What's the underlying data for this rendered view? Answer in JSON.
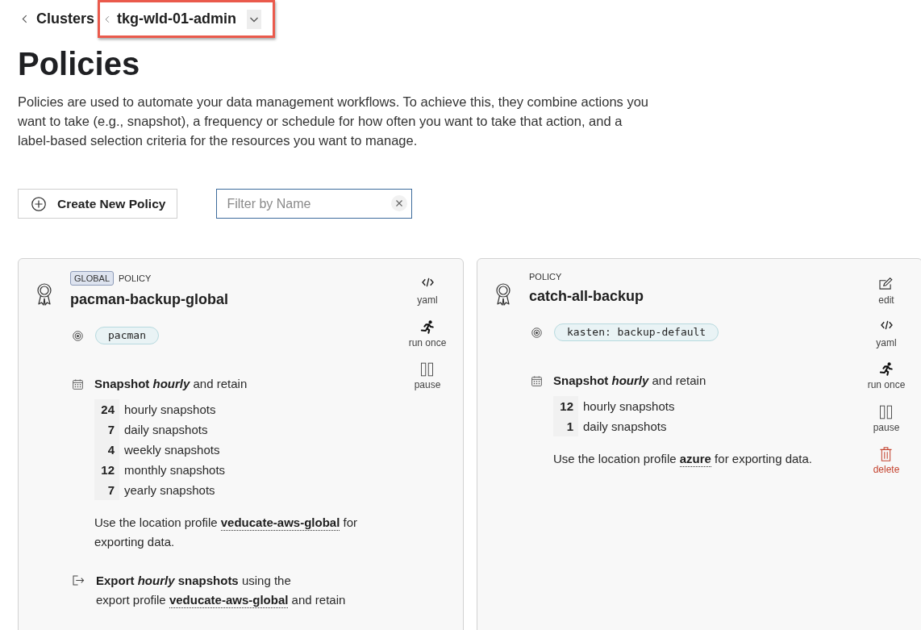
{
  "breadcrumb": {
    "parent": "Clusters",
    "cluster": {
      "name": "tkg-wld-01-admin",
      "highlighted": true
    }
  },
  "title": "Policies",
  "description": "Policies are used to automate your data management workflows. To achieve this, they combine actions you want to take (e.g., snapshot), a frequency or schedule for how often you want to take that action, and a label-based selection criteria for the resources you want to manage.",
  "toolbar": {
    "create_button": "Create New Policy",
    "filter": {
      "placeholder": "Filter by Name"
    }
  },
  "policies": [
    {
      "badge": "GLOBAL",
      "type_label": "POLICY",
      "name": "pacman-backup-global",
      "selector": "pacman",
      "schedule": {
        "action": "Snapshot",
        "frequency": "hourly",
        "suffix": "and retain"
      },
      "retention": [
        {
          "count": "24",
          "unit": "hourly snapshots"
        },
        {
          "count": "7",
          "unit": "daily snapshots"
        },
        {
          "count": "4",
          "unit": "weekly snapshots"
        },
        {
          "count": "12",
          "unit": "monthly snapshots"
        },
        {
          "count": "7",
          "unit": "yearly snapshots"
        }
      ],
      "location": {
        "prefix": "Use the location profile",
        "profile": "veducate-aws-global",
        "suffix": "for exporting data."
      },
      "export": {
        "action": "Export",
        "frequency": "hourly",
        "object": "snapshots",
        "suffix": "using the",
        "profile_prefix": "export profile",
        "profile": "veducate-aws-global",
        "profile_suffix": "and retain"
      },
      "actions": [
        {
          "kind": "yaml",
          "label": "yaml"
        },
        {
          "kind": "run_once",
          "label": "run once"
        },
        {
          "kind": "pause",
          "label": "pause"
        }
      ]
    },
    {
      "type_label": "POLICY",
      "name": "catch-all-backup",
      "selector": "kasten: backup-default",
      "schedule": {
        "action": "Snapshot",
        "frequency": "hourly",
        "suffix": "and retain"
      },
      "retention": [
        {
          "count": "12",
          "unit": "hourly snapshots"
        },
        {
          "count": "1",
          "unit": "daily snapshots"
        }
      ],
      "location": {
        "prefix": "Use the location profile",
        "profile": "azure",
        "suffix": "for exporting data."
      },
      "actions": [
        {
          "kind": "edit",
          "label": "edit"
        },
        {
          "kind": "yaml",
          "label": "yaml"
        },
        {
          "kind": "run_once",
          "label": "run once"
        },
        {
          "kind": "pause",
          "label": "pause"
        },
        {
          "kind": "delete",
          "label": "delete"
        }
      ]
    }
  ]
}
